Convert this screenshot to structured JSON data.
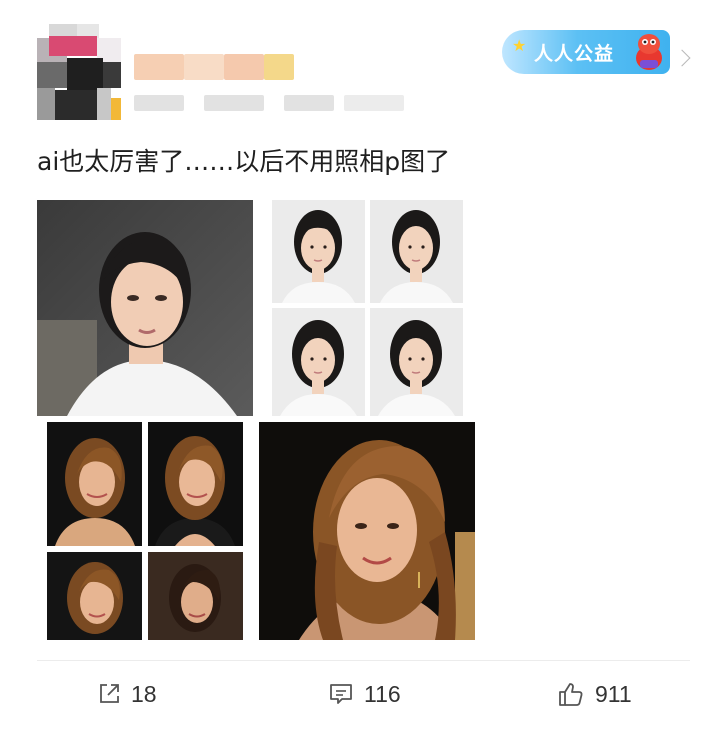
{
  "post": {
    "text": "ai也太厉害了……以后不用照相p图了"
  },
  "badge": {
    "label": "人人公益",
    "icon": "charity-badge-icon"
  },
  "actions": {
    "repost_count": "18",
    "comment_count": "116",
    "like_count": "911"
  },
  "icons": {
    "repost": "share-arrow-icon",
    "comment": "comment-bubble-icon",
    "like": "thumbs-up-icon",
    "more": "chevron-right-icon"
  },
  "colors": {
    "badge_blue": "#3fb2ef",
    "text": "#1f1f1f",
    "action_text": "#333333"
  }
}
